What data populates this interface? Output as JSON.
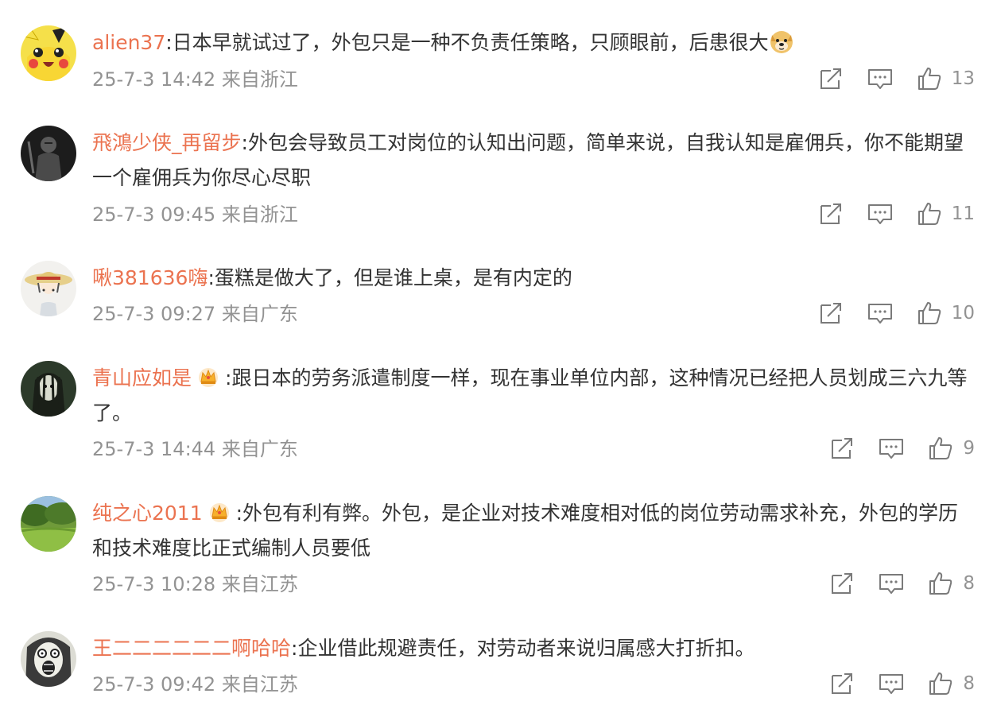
{
  "comments": [
    {
      "user": "alien37",
      "text": ":日本早就试过了，外包只是一种不负责任策略，只顾眼前，后患很大",
      "emoji": "doge-emoji",
      "time": "25-7-3 14:42 来自浙江",
      "likes": "13",
      "avatar": "pikachu-avatar"
    },
    {
      "user": "飛鴻少侠_再留步",
      "text": ":外包会导致员工对岗位的认知出问题，简单来说，自我认知是雇佣兵，你不能期望一个雇佣兵为你尽心尽职",
      "time": "25-7-3 09:45 来自浙江",
      "likes": "11",
      "avatar": "dark-figure-avatar"
    },
    {
      "user": "啾381636嗨",
      "text": ":蛋糕是做大了，但是谁上桌，是有内定的",
      "time": "25-7-3 09:27 来自广东",
      "likes": "10",
      "avatar": "straw-hat-avatar"
    },
    {
      "user": "青山应如是",
      "badge": "crown-badge",
      "text": ":跟日本的劳务派遣制度一样，现在事业单位内部，这种情况已经把人员划成三六九等了。",
      "time": "25-7-3 14:44 来自广东",
      "likes": "9",
      "avatar": "ghost-avatar"
    },
    {
      "user": "纯之心2011",
      "badge": "crown-badge",
      "text": ":外包有利有弊。外包，是企业对技术难度相对低的岗位劳动需求补充，外包的学历和技术难度比正式编制人员要低",
      "time": "25-7-3 10:28 来自江苏",
      "likes": "8",
      "avatar": "garden-avatar"
    },
    {
      "user": "王二二二二二二啊哈哈",
      "text": ":企业借此规避责任，对劳动者来说归属感大打折扣。",
      "time": "25-7-3 09:42 来自江苏",
      "likes": "8",
      "avatar": "screaming-face-avatar"
    }
  ],
  "colors": {
    "username": "#eb7350",
    "meta": "#939393",
    "text": "#333333"
  }
}
